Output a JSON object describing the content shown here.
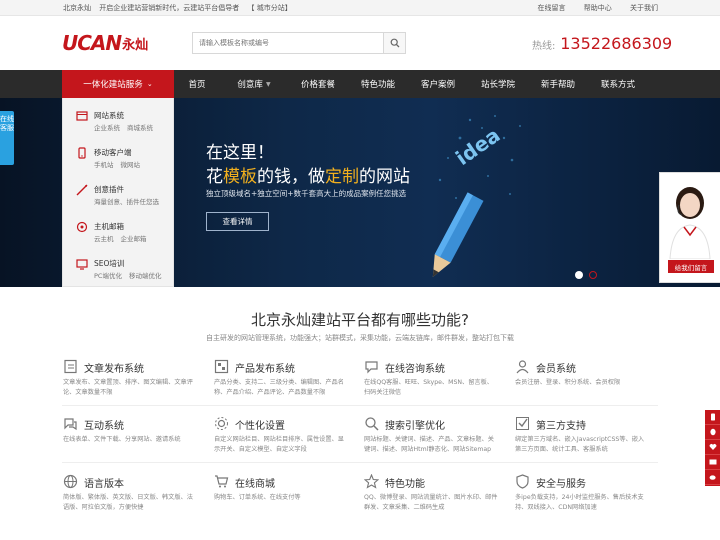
{
  "topbar": {
    "items": [
      "北京永灿",
      "开启企业建站营销新时代，云建站平台倡导者",
      "【 城市分站】"
    ],
    "links": [
      "在线留言",
      "帮助中心",
      "关于我们"
    ]
  },
  "header": {
    "logo_text": "UCAN",
    "logo_cn": "永灿",
    "search_placeholder": "请输入模板名称或编号",
    "hotline_label": "热线:",
    "hotline_number": "13522686309"
  },
  "nav": {
    "category_label": "一体化建站服务",
    "items": [
      {
        "label": "首页",
        "has_caret": false
      },
      {
        "label": "创意库",
        "has_caret": true
      },
      {
        "label": "价格套餐",
        "has_caret": false
      },
      {
        "label": "特色功能",
        "has_caret": false
      },
      {
        "label": "客户案例",
        "has_caret": false
      },
      {
        "label": "站长学院",
        "has_caret": false
      },
      {
        "label": "新手帮助",
        "has_caret": false
      },
      {
        "label": "联系方式",
        "has_caret": false
      }
    ]
  },
  "category_panel": [
    {
      "title": "网站系统",
      "subs": [
        "企业系统",
        "商城系统"
      ],
      "icon": "website-icon"
    },
    {
      "title": "移动客户端",
      "subs": [
        "手机站",
        "微网站"
      ],
      "icon": "mobile-icon"
    },
    {
      "title": "创意插件",
      "subs": [
        "海量创意、插件任您选"
      ],
      "icon": "plugin-icon"
    },
    {
      "title": "主机邮箱",
      "subs": [
        "云主机",
        "企业邮箱"
      ],
      "icon": "host-icon"
    },
    {
      "title": "SEO培训",
      "subs": [
        "PC端优化",
        "移动端优化"
      ],
      "icon": "seo-icon"
    }
  ],
  "banner": {
    "line1": "在这里！",
    "line2_a": "花",
    "line2_b": "模板",
    "line2_c": "的钱，做",
    "line2_d": "定制",
    "line2_e": "的网站",
    "line3": "独立顶级域名+独立空间+数千套高大上的成品案例任您挑选",
    "more_label": "查看详情",
    "colors": {
      "gold": "#f2b01e"
    }
  },
  "side_service": {
    "label": "在线客服"
  },
  "consultant": {
    "button_label": "给我们留言"
  },
  "features": {
    "title": "北京永灿建站平台都有哪些功能?",
    "subtitle": "自主研发的网站管理系统，功能强大；站群模式，采集功能，云端友链库，邮件群发，整站打包下载",
    "items": [
      {
        "title": "文章发布系统",
        "desc": "文章发布、文章置顶、排序、图文编辑、文章评论、文章数量不限",
        "icon": "article-icon"
      },
      {
        "title": "产品发布系统",
        "desc": "产品分类、支持二、三级分类、编辑图、产品名称、产品介绍、产品评论、产品数量不限",
        "icon": "product-icon"
      },
      {
        "title": "在线咨询系统",
        "desc": "在线QQ客服、旺旺、Skype、MSN、留言板、扫码关注微信",
        "icon": "chat-icon"
      },
      {
        "title": "会员系统",
        "desc": "会员注册、登录、积分系统、会员权限",
        "icon": "member-icon"
      },
      {
        "title": "互动系统",
        "desc": "在线表单、文件下载、分享网站、邀请系统",
        "icon": "interact-icon"
      },
      {
        "title": "个性化设置",
        "desc": "自定义网站栏目、网站栏目排序、属性设置、显示开关、自定义模型、自定义字段",
        "icon": "custom-icon"
      },
      {
        "title": "搜索引擎优化",
        "desc": "网站标题、关键词、描述、产品、文章标题、关键词、描述、网站Html静态化、网站Sitemap",
        "icon": "seo-search-icon"
      },
      {
        "title": "第三方支持",
        "desc": "绑定第三方域名、嵌入JavascriptCSS等、嵌入第三方页面、统计工具、客服系统",
        "icon": "thirdparty-icon"
      },
      {
        "title": "语言版本",
        "desc": "简体版、繁体版、英文版、日文版、韩文版、法语版、阿拉伯文版，方便快捷",
        "icon": "language-icon"
      },
      {
        "title": "在线商城",
        "desc": "购物车、订单系统、在线支付等",
        "icon": "shop-icon"
      },
      {
        "title": "特色功能",
        "desc": "QQ、微博登录、网站流量统计、图片水印、邮件群发、文章采集、二维码生成",
        "icon": "star-icon"
      },
      {
        "title": "安全与服务",
        "desc": "多ipe负载支持，24小时监控服务、售后技术支持、双线接入、CDN网络加速",
        "icon": "safety-icon"
      }
    ]
  },
  "colors": {
    "brand": "#c4161c",
    "nav_bg": "#2b2b2b",
    "service_blue": "#2aa1e0"
  }
}
